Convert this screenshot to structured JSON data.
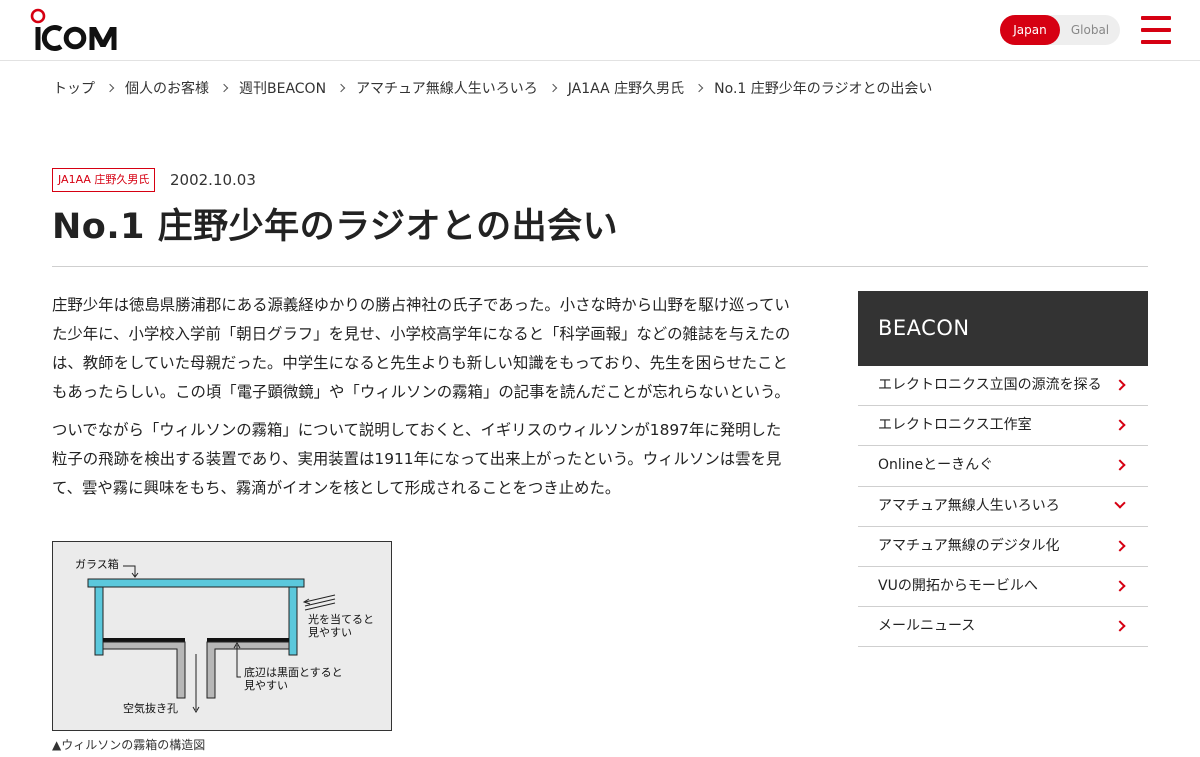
{
  "header": {
    "logo_text": "ICOM",
    "lang_japan": "Japan",
    "lang_global": "Global",
    "menu_icon": "hamburger-menu-icon",
    "accent_color": "#d60012"
  },
  "breadcrumb": [
    "トップ",
    "個人のお客様",
    "週刊BEACON",
    "アマチュア無線人生いろいろ",
    "JA1AA 庄野久男氏",
    "No.1 庄野少年のラジオとの出会い"
  ],
  "article": {
    "tag": "JA1AA 庄野久男氏",
    "date": "2002.10.03",
    "title": "No.1 庄野少年のラジオとの出会い",
    "paragraphs": [
      "庄野少年は徳島県勝浦郡にある源義経ゆかりの勝占神社の氏子であった。小さな時から山野を駆け巡っていた少年に、小学校入学前「朝日グラフ」を見せ、小学校高学年になると「科学画報」などの雑誌を与えたのは、教師をしていた母親だった。中学生になると先生よりも新しい知識をもっており、先生を困らせたこともあったらしい。この頃「電子顕微鏡」や「ウィルソンの霧箱」の記事を読んだことが忘れらないという。",
      "ついでながら「ウィルソンの霧箱」について説明しておくと、イギリスのウィルソンが1897年に発明した粒子の飛跡を検出する装置であり、実用装置は1911年になって出来上がったという。ウィルソンは雲を見て、雲や霧に興味をもち、霧滴がイオンを核として形成されることをつき止めた。"
    ],
    "figure": {
      "label_glass": "ガラス箱",
      "label_light_1": "光を当てると",
      "label_light_2": "見やすい",
      "label_bottom_1": "底辺は黒面とすると",
      "label_bottom_2": "見やすい",
      "label_air": "空気抜き孔"
    },
    "caption": "▲ウィルソンの霧箱の構造図"
  },
  "sidebar": {
    "heading": "BEACON",
    "items": [
      {
        "label": "エレクトロニクス立国の源流を探る",
        "icon": "chevron-right-icon"
      },
      {
        "label": "エレクトロニクス工作室",
        "icon": "chevron-right-icon"
      },
      {
        "label": "Onlineとーきんぐ",
        "icon": "chevron-right-icon"
      },
      {
        "label": "アマチュア無線人生いろいろ",
        "icon": "chevron-down-icon"
      },
      {
        "label": "アマチュア無線のデジタル化",
        "icon": "chevron-right-icon"
      },
      {
        "label": "VUの開拓からモービルへ",
        "icon": "chevron-right-icon"
      },
      {
        "label": "メールニュース",
        "icon": "chevron-right-icon"
      }
    ]
  }
}
